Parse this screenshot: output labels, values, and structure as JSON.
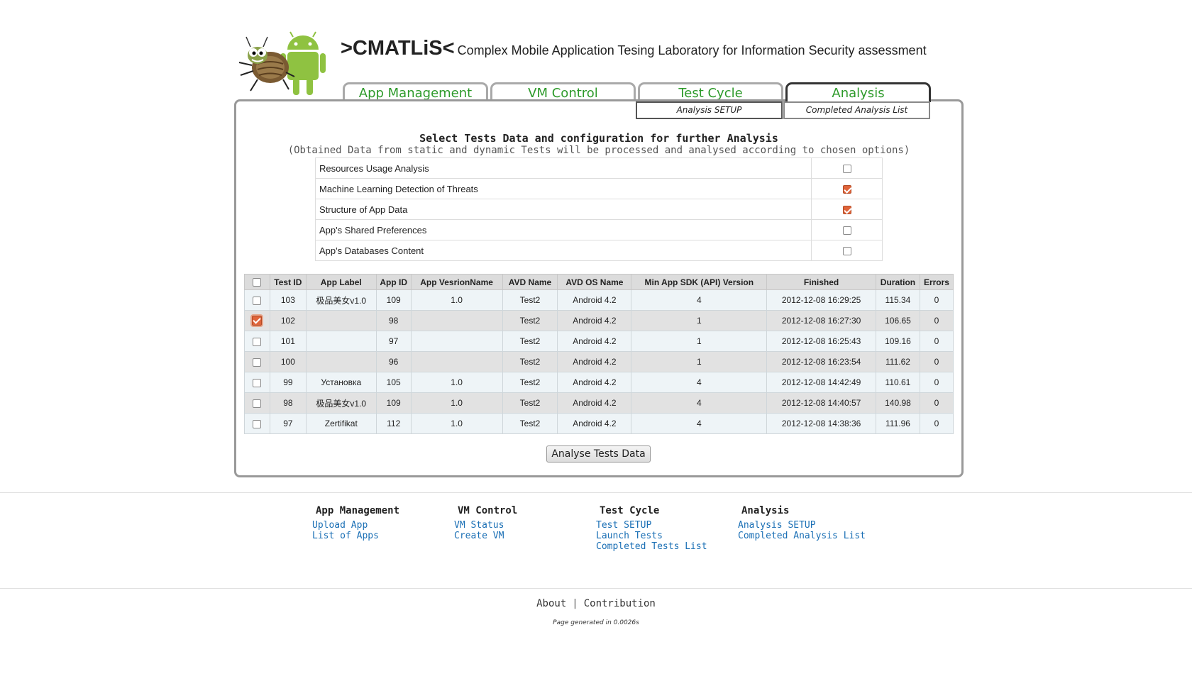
{
  "header": {
    "brand": ">CMATLiS<",
    "tagline": "Complex Mobile Application Tesing Laboratory for Information Security assessment"
  },
  "tabs": [
    {
      "label": "App Management"
    },
    {
      "label": "VM Control"
    },
    {
      "label": "Test Cycle"
    },
    {
      "label": "Analysis",
      "active": true
    }
  ],
  "subtabs": [
    {
      "label": "Analysis SETUP"
    },
    {
      "label": "Completed Analysis List"
    }
  ],
  "setup": {
    "title": "Select Tests Data and configuration for further Analysis",
    "subtitle": "(Obtained Data from static and dynamic Tests will be processed and analysed according to chosen options)",
    "options": [
      {
        "label": "Resources Usage Analysis",
        "checked": false
      },
      {
        "label": "Machine Learning Detection of Threats",
        "checked": true
      },
      {
        "label": "Structure of App Data",
        "checked": true
      },
      {
        "label": "App's Shared Preferences",
        "checked": false
      },
      {
        "label": "App's Databases Content",
        "checked": false
      }
    ]
  },
  "tests": {
    "columns": [
      "Test ID",
      "App Label",
      "App ID",
      "App VesrionName",
      "AVD Name",
      "AVD OS Name",
      "Min App SDK (API) Version",
      "Finished",
      "Duration",
      "Errors"
    ],
    "rows": [
      {
        "checked": false,
        "cells": [
          "103",
          "极品美女v1.0",
          "109",
          "1.0",
          "Test2",
          "Android 4.2",
          "4",
          "2012-12-08 16:29:25",
          "115.34",
          "0"
        ]
      },
      {
        "checked": true,
        "cells": [
          "102",
          "",
          "98",
          "",
          "Test2",
          "Android 4.2",
          "1",
          "2012-12-08 16:27:30",
          "106.65",
          "0"
        ]
      },
      {
        "checked": false,
        "cells": [
          "101",
          "",
          "97",
          "",
          "Test2",
          "Android 4.2",
          "1",
          "2012-12-08 16:25:43",
          "109.16",
          "0"
        ]
      },
      {
        "checked": false,
        "cells": [
          "100",
          "",
          "96",
          "",
          "Test2",
          "Android 4.2",
          "1",
          "2012-12-08 16:23:54",
          "111.62",
          "0"
        ]
      },
      {
        "checked": false,
        "cells": [
          "99",
          "Установка",
          "105",
          "1.0",
          "Test2",
          "Android 4.2",
          "4",
          "2012-12-08 14:42:49",
          "110.61",
          "0"
        ]
      },
      {
        "checked": false,
        "cells": [
          "98",
          "极品美女v1.0",
          "109",
          "1.0",
          "Test2",
          "Android 4.2",
          "4",
          "2012-12-08 14:40:57",
          "140.98",
          "0"
        ]
      },
      {
        "checked": false,
        "cells": [
          "97",
          "Zertifikat",
          "112",
          "1.0",
          "Test2",
          "Android 4.2",
          "4",
          "2012-12-08 14:38:36",
          "111.96",
          "0"
        ]
      }
    ],
    "submit_label": "Analyse Tests Data"
  },
  "footer": {
    "columns": [
      {
        "title": "App Management",
        "links": [
          "Upload App",
          "List of Apps"
        ]
      },
      {
        "title": "VM Control",
        "links": [
          "VM Status",
          "Create VM"
        ]
      },
      {
        "title": "Test Cycle",
        "links": [
          "Test SETUP",
          "Launch Tests",
          "Completed Tests List"
        ]
      },
      {
        "title": "Analysis",
        "links": [
          "Analysis SETUP",
          "Completed Analysis List"
        ]
      }
    ],
    "about": "About",
    "separator": "|",
    "contribution": "Contribution",
    "generated": "Page generated in 0.0026s"
  },
  "colors": {
    "tab_text": "#2d9a2a",
    "checkbox_checked": "#e0643a",
    "link": "#1a6fb5",
    "row_odd": "#eef4f7",
    "row_even": "#e2e2e2"
  }
}
